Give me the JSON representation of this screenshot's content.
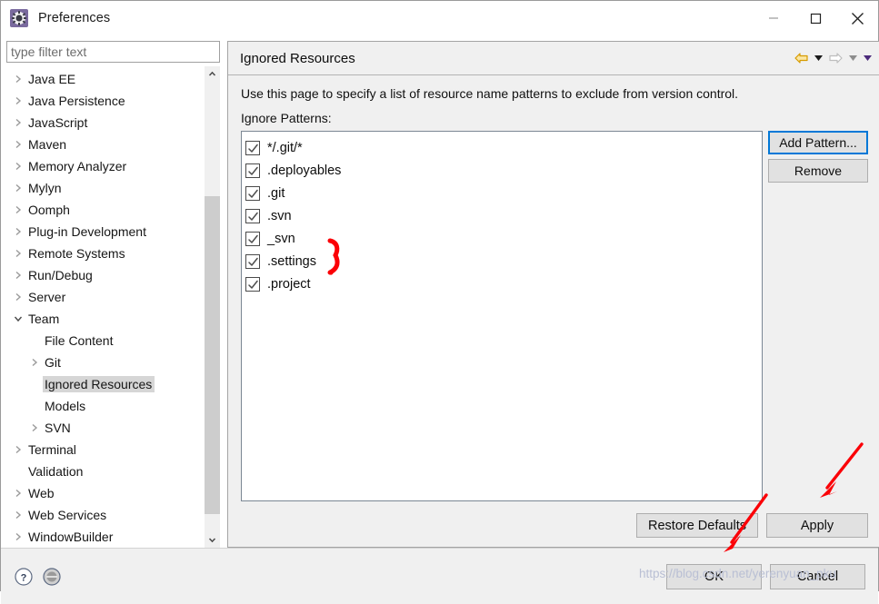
{
  "window": {
    "title": "Preferences",
    "icon": "preferences-gear-icon",
    "minimize_label": "Minimize",
    "maximize_label": "Maximize",
    "close_label": "Close"
  },
  "sidebar": {
    "filter": {
      "placeholder": "type filter text",
      "value": ""
    },
    "items": [
      {
        "label": "Java EE",
        "depth": 1,
        "twisty": "collapsed",
        "selected": false
      },
      {
        "label": "Java Persistence",
        "depth": 1,
        "twisty": "collapsed",
        "selected": false
      },
      {
        "label": "JavaScript",
        "depth": 1,
        "twisty": "collapsed",
        "selected": false
      },
      {
        "label": "Maven",
        "depth": 1,
        "twisty": "collapsed",
        "selected": false
      },
      {
        "label": "Memory Analyzer",
        "depth": 1,
        "twisty": "collapsed",
        "selected": false
      },
      {
        "label": "Mylyn",
        "depth": 1,
        "twisty": "collapsed",
        "selected": false
      },
      {
        "label": "Oomph",
        "depth": 1,
        "twisty": "collapsed",
        "selected": false
      },
      {
        "label": "Plug-in Development",
        "depth": 1,
        "twisty": "collapsed",
        "selected": false
      },
      {
        "label": "Remote Systems",
        "depth": 1,
        "twisty": "collapsed",
        "selected": false
      },
      {
        "label": "Run/Debug",
        "depth": 1,
        "twisty": "collapsed",
        "selected": false
      },
      {
        "label": "Server",
        "depth": 1,
        "twisty": "collapsed",
        "selected": false
      },
      {
        "label": "Team",
        "depth": 1,
        "twisty": "expanded",
        "selected": false
      },
      {
        "label": "File Content",
        "depth": 2,
        "twisty": "none",
        "selected": false
      },
      {
        "label": "Git",
        "depth": 2,
        "twisty": "collapsed",
        "selected": false
      },
      {
        "label": "Ignored Resources",
        "depth": 2,
        "twisty": "none",
        "selected": true
      },
      {
        "label": "Models",
        "depth": 2,
        "twisty": "none",
        "selected": false
      },
      {
        "label": "SVN",
        "depth": 2,
        "twisty": "collapsed",
        "selected": false
      },
      {
        "label": "Terminal",
        "depth": 1,
        "twisty": "collapsed",
        "selected": false
      },
      {
        "label": "Validation",
        "depth": 1,
        "twisty": "none",
        "selected": false
      },
      {
        "label": "Web",
        "depth": 1,
        "twisty": "collapsed",
        "selected": false
      },
      {
        "label": "Web Services",
        "depth": 1,
        "twisty": "collapsed",
        "selected": false
      },
      {
        "label": "WindowBuilder",
        "depth": 1,
        "twisty": "collapsed",
        "selected": false
      }
    ],
    "scrollbar": {
      "up_icon": "chevron-up-icon",
      "down_icon": "chevron-down-icon"
    }
  },
  "page": {
    "title": "Ignored Resources",
    "description": "Use this page to specify a list of resource name patterns to exclude from version control.",
    "patterns_label": "Ignore Patterns:",
    "nav": {
      "back_icon": "back-arrow-icon",
      "back_menu_icon": "caret-down-icon",
      "forward_icon": "forward-arrow-icon",
      "forward_menu_icon": "caret-down-icon",
      "overflow_menu_icon": "caret-down-icon"
    },
    "patterns": [
      {
        "label": "*/.git/*",
        "checked": true
      },
      {
        "label": ".deployables",
        "checked": true
      },
      {
        "label": ".git",
        "checked": true
      },
      {
        "label": ".svn",
        "checked": true
      },
      {
        "label": "_svn",
        "checked": true
      },
      {
        "label": ".settings",
        "checked": true
      },
      {
        "label": ".project",
        "checked": true
      }
    ],
    "side_buttons": [
      {
        "label": "Add Pattern...",
        "focused": true
      },
      {
        "label": "Remove",
        "focused": false
      }
    ],
    "apply_buttons": [
      {
        "label": "Restore Defaults"
      },
      {
        "label": "Apply"
      }
    ]
  },
  "footer": {
    "help_icon": "question-mark-icon",
    "secondary_icon": "contents-circle-icon",
    "buttons": [
      {
        "label": "OK",
        "default": true
      },
      {
        "label": "Cancel",
        "default": false
      }
    ]
  },
  "annotations": {
    "color": "#fb0007",
    "watermark": "https://blog.csdn.net/yerenyuan_pku",
    "watermark_color": "#b9bfd4",
    "brace_label": "brace-grouping-settings-project",
    "arrow_apply_label": "arrow-pointing-to-apply",
    "arrow_ok_label": "arrow-pointing-to-ok"
  }
}
